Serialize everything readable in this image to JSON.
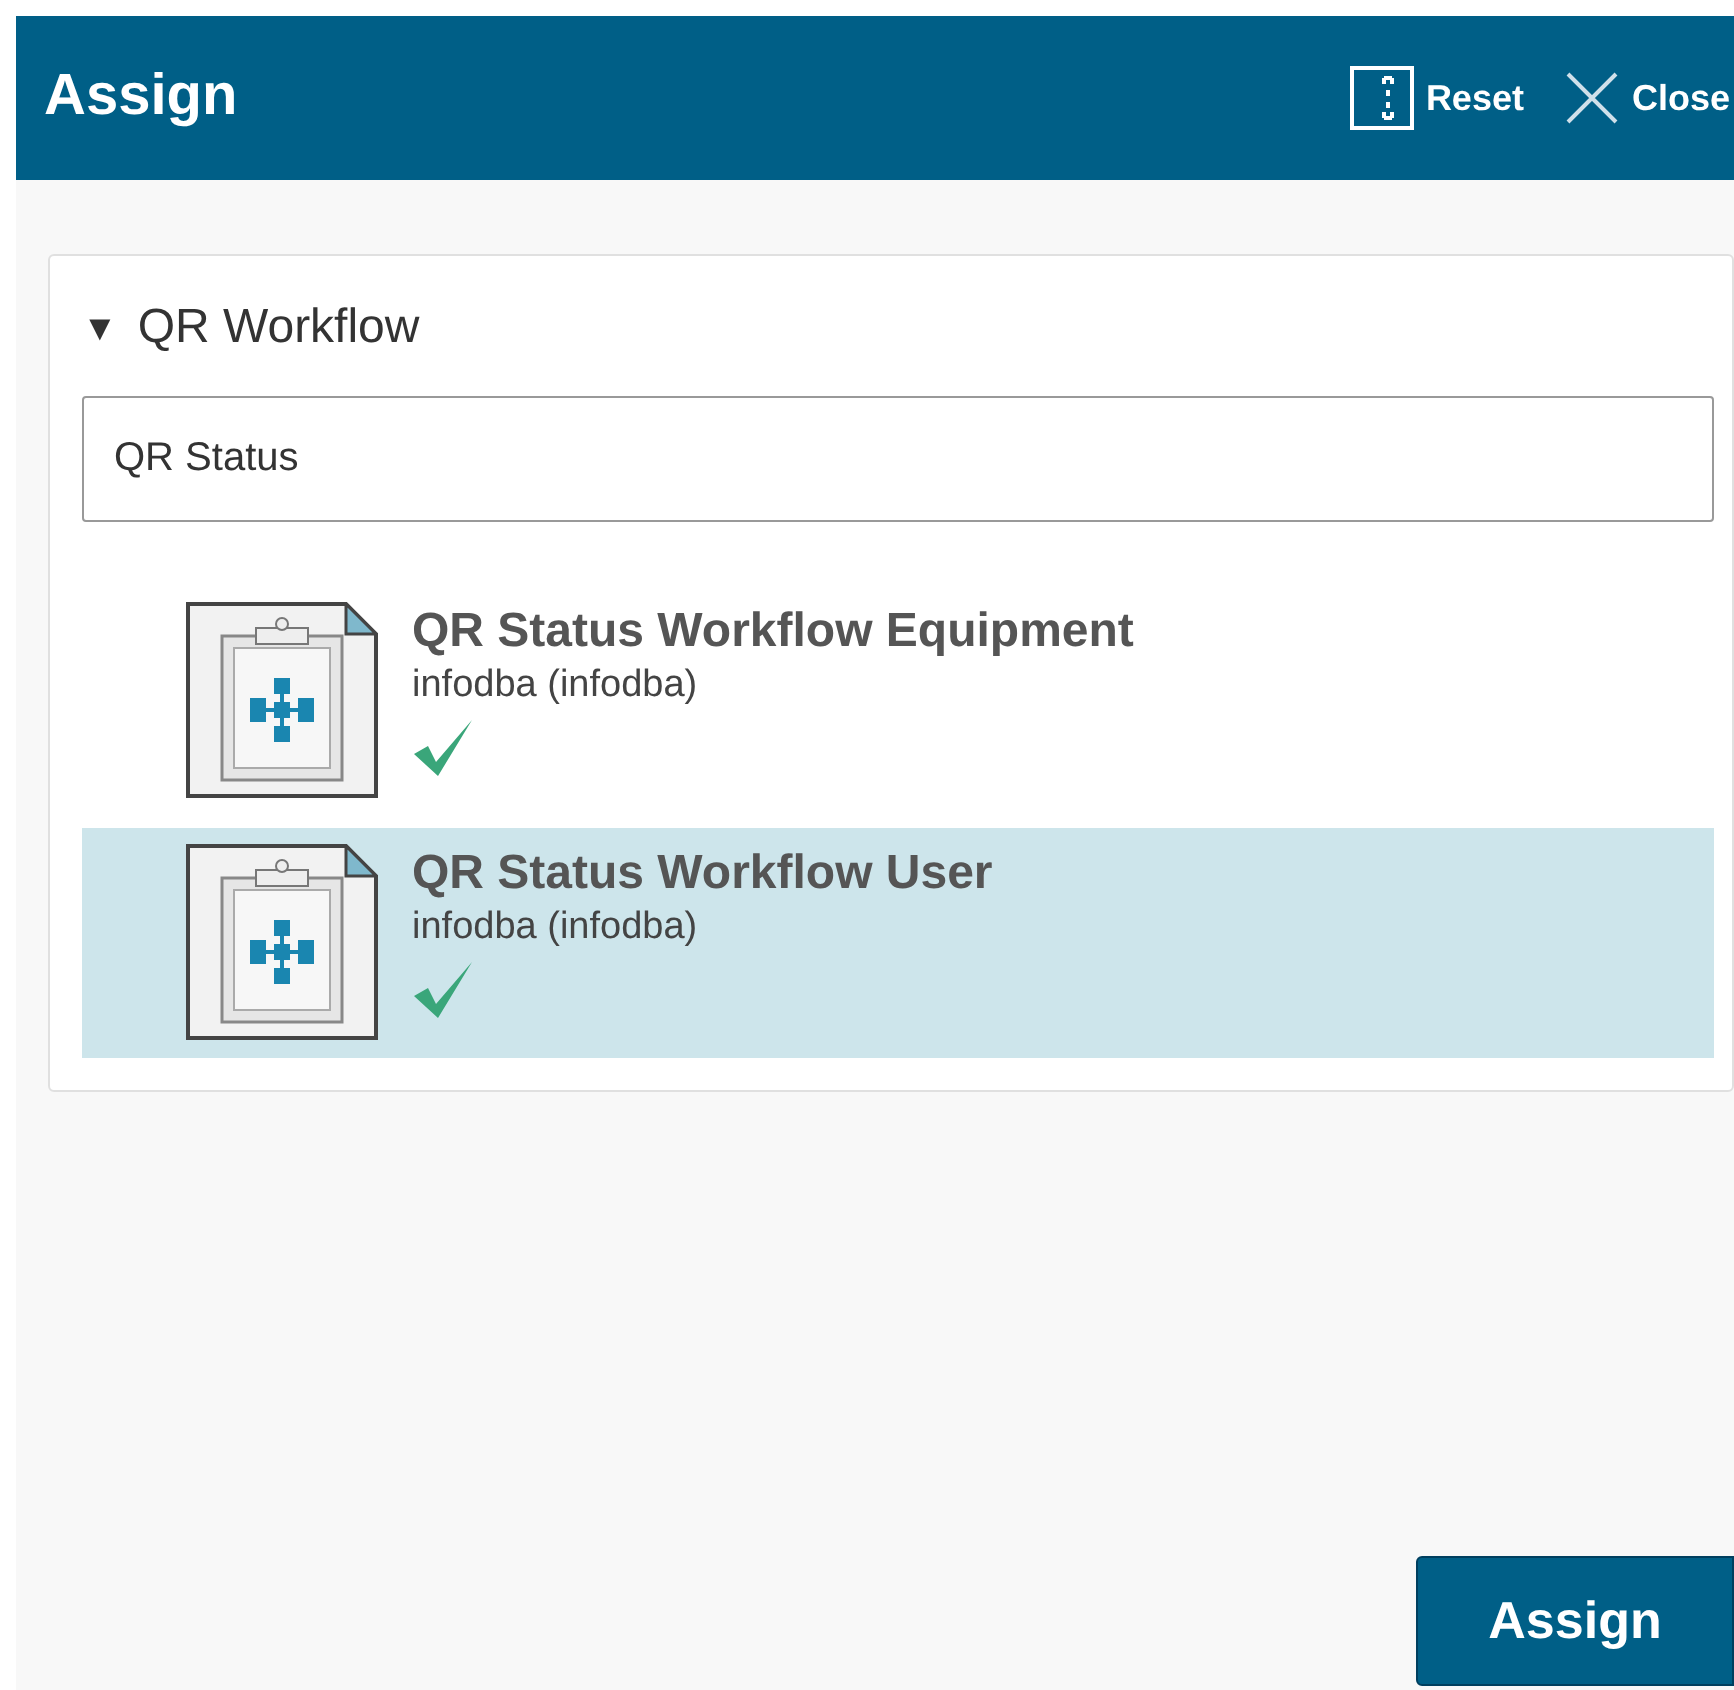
{
  "header": {
    "title": "Assign",
    "actions": [
      {
        "kind": "reset",
        "label": "Reset"
      },
      {
        "kind": "close",
        "label": "Close"
      }
    ]
  },
  "section": {
    "title": "QR Workflow",
    "expanded": true,
    "caret": "▼"
  },
  "search": {
    "value": "QR Status"
  },
  "results": [
    {
      "title": "QR Status Workflow Equipment",
      "owner": "infodba (infodba)",
      "selected": false
    },
    {
      "title": "QR Status Workflow User",
      "owner": "infodba (infodba)",
      "selected": true
    }
  ],
  "footer": {
    "button": "Assign"
  }
}
